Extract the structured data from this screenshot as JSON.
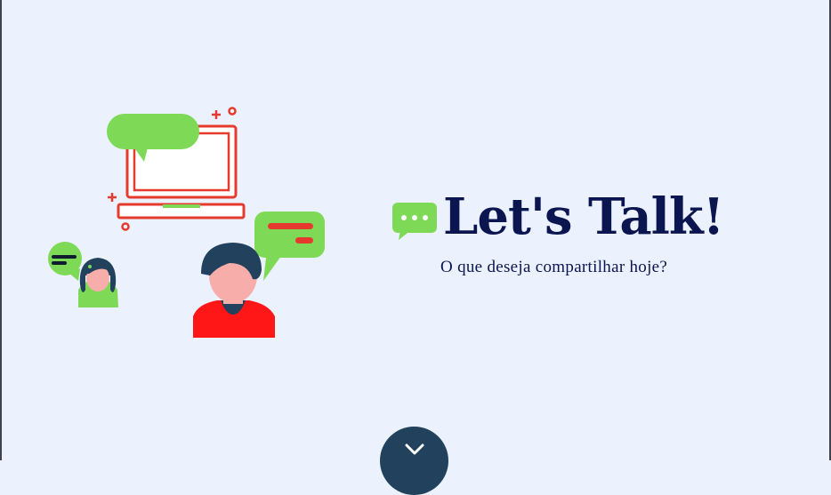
{
  "hero": {
    "title": "Let's Talk!",
    "subtitle": "O que deseja compartilhar hoje?"
  },
  "icons": {
    "hero_icon": "chat-bubble-icon",
    "scroll_icon": "chevron-down-icon",
    "illustration": "people-chatting-illustration"
  },
  "colors": {
    "background": "#ebf1fd",
    "title": "#0b1550",
    "accent_green": "#7ed957",
    "accent_red": "#e63a2e",
    "scroll_button": "#22415c"
  }
}
